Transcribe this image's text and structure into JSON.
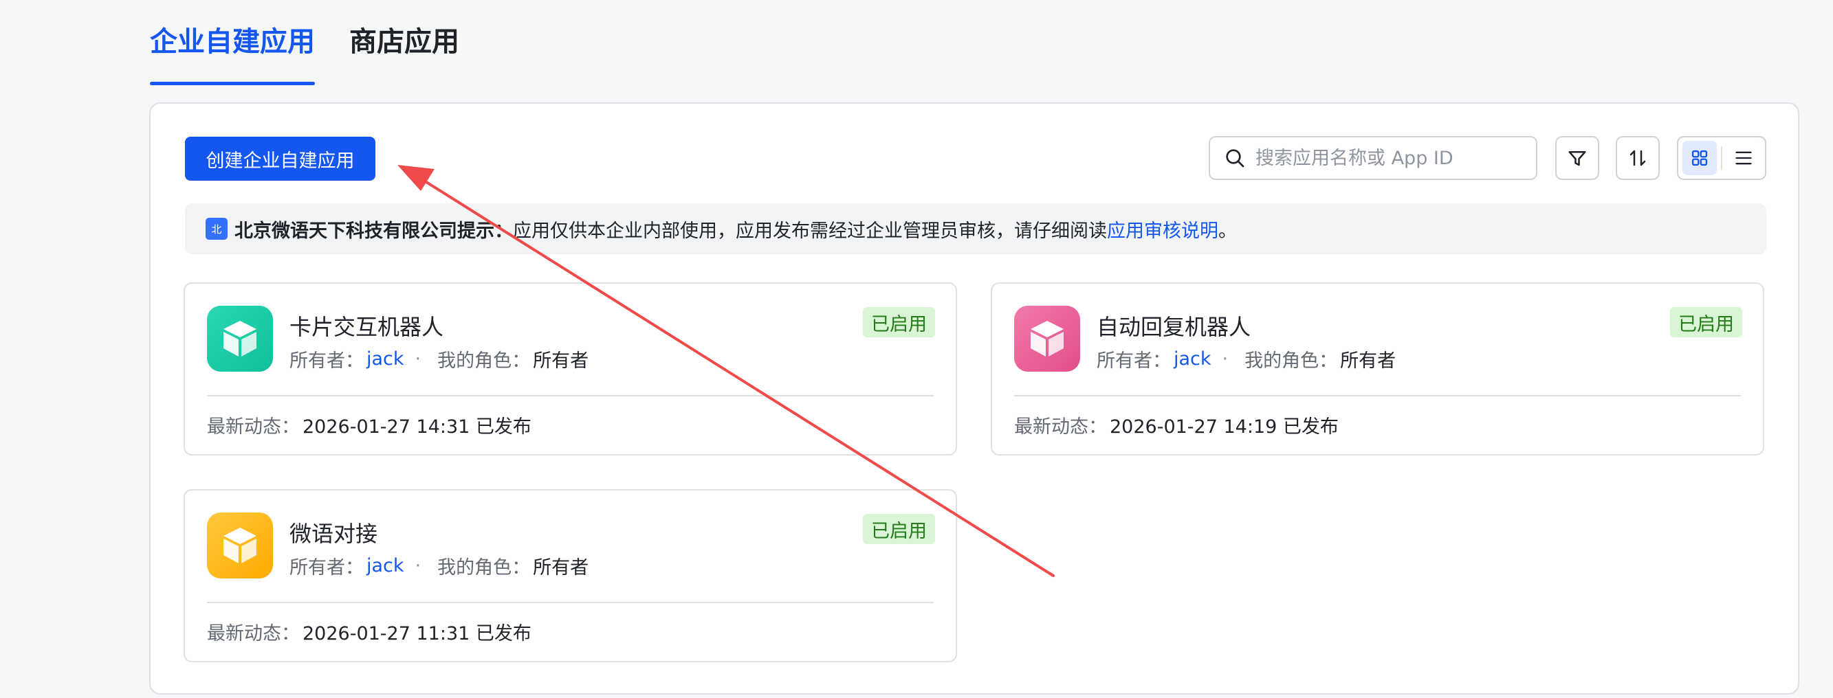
{
  "tabs": [
    {
      "label": "企业自建应用",
      "active": true
    },
    {
      "label": "商店应用",
      "active": false
    }
  ],
  "toolbar": {
    "create_label": "创建企业自建应用",
    "search_placeholder": "搜索应用名称或 App ID",
    "search_value": ""
  },
  "notice": {
    "badge": "北",
    "company": "北京微语天下科技有限公司提示：",
    "message": "应用仅供本企业内部使用，应用发布需经过企业管理员审核，请仔细阅读 ",
    "link": "应用审核说明",
    "suffix": "。"
  },
  "apps": [
    {
      "name": "卡片交互机器人",
      "status": "已启用",
      "owner_label": "所有者：",
      "owner": "jack",
      "separator": "·",
      "role_label": "我的角色：",
      "role": "所有者",
      "activity_label": "最新动态：",
      "activity": "2026-01-27 14:31 已发布",
      "icon_color": "#14c9a6"
    },
    {
      "name": "自动回复机器人",
      "status": "已启用",
      "owner_label": "所有者：",
      "owner": "jack",
      "separator": "·",
      "role_label": "我的角色：",
      "role": "所有者",
      "activity_label": "最新动态：",
      "activity": "2026-01-27 14:19 已发布",
      "icon_color": "#eb5d96"
    },
    {
      "name": "微语对接",
      "status": "已启用",
      "owner_label": "所有者：",
      "owner": "jack",
      "separator": "·",
      "role_label": "我的角色：",
      "role": "所有者",
      "activity_label": "最新动态：",
      "activity": "2026-01-27 11:31 已发布",
      "icon_color": "#ffb400"
    }
  ],
  "colors": {
    "accent": "#1456f0",
    "status_bg": "#d9f5d6",
    "status_text": "#237b19",
    "annotation_arrow": "#f04a4a"
  },
  "icons": {
    "search": "search-icon",
    "filter": "filter-icon",
    "sort": "sort-icon",
    "grid_view": "grid-view-icon",
    "list_view": "list-view-icon",
    "app": "cube-icon"
  }
}
